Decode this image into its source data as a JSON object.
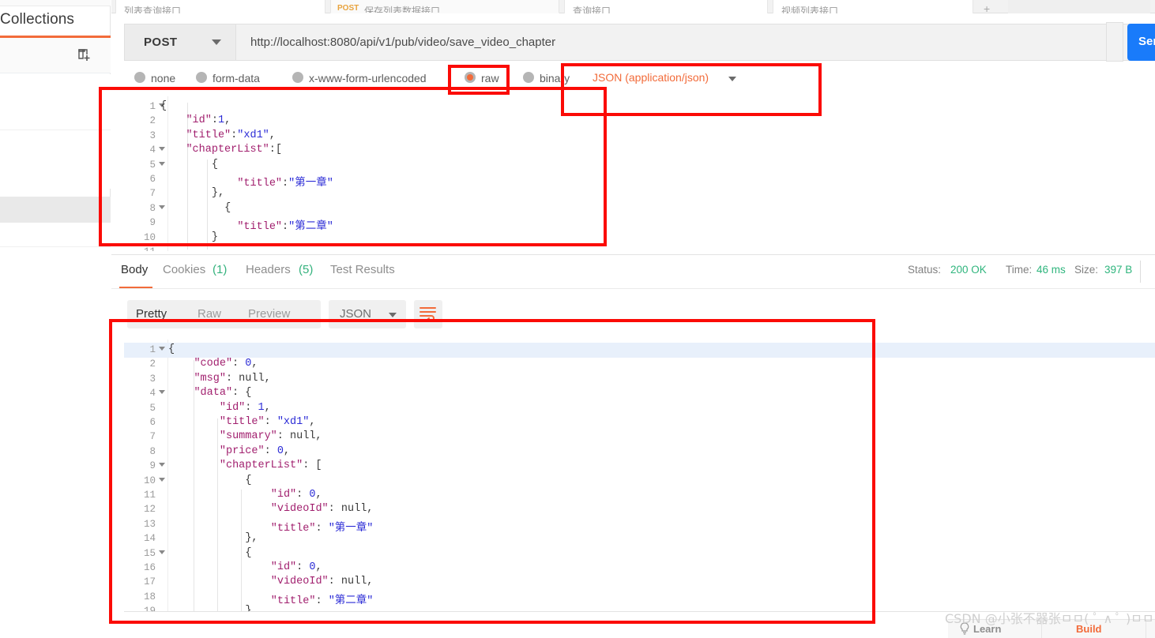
{
  "sidebar": {
    "title": "Collections",
    "new_folder_icon": "new-folder-icon"
  },
  "tabstrip": {
    "tabs": [
      {
        "label": "列表查询接口",
        "method": "",
        "dirty": false
      },
      {
        "label": "保存列表数据接口",
        "method": "POST",
        "dirty": true
      },
      {
        "label": "查询接口",
        "method": "",
        "dirty": false
      },
      {
        "label": "视频列表接口",
        "method": "",
        "dirty": false
      }
    ],
    "plus_label": "+"
  },
  "request": {
    "method": "POST",
    "url": "http://localhost:8080/api/v1/pub/video/save_video_chapter",
    "send_label": "Send",
    "body_types": [
      {
        "label": "none",
        "selected": false
      },
      {
        "label": "form-data",
        "selected": false
      },
      {
        "label": "x-www-form-urlencoded",
        "selected": false
      },
      {
        "label": "raw",
        "selected": true
      },
      {
        "label": "binary",
        "selected": false
      }
    ],
    "raw_format": "JSON (application/json)",
    "body_lines": [
      {
        "n": "1",
        "fold": true,
        "text": "{"
      },
      {
        "n": "2",
        "fold": false,
        "text": "    \"id\":1,"
      },
      {
        "n": "3",
        "fold": false,
        "text": "    \"title\":\"xd1\","
      },
      {
        "n": "4",
        "fold": true,
        "text": "    \"chapterList\":["
      },
      {
        "n": "5",
        "fold": true,
        "text": "        {"
      },
      {
        "n": "6",
        "fold": false,
        "text": "            \"title\":\"第一章\""
      },
      {
        "n": "7",
        "fold": false,
        "text": "        },"
      },
      {
        "n": "8",
        "fold": true,
        "text": "          {"
      },
      {
        "n": "9",
        "fold": false,
        "text": "            \"title\":\"第二章\""
      },
      {
        "n": "10",
        "fold": false,
        "text": "        }"
      },
      {
        "n": "11",
        "fold": false,
        "text": ""
      }
    ]
  },
  "response": {
    "tabs": [
      {
        "label": "Body",
        "count": "",
        "active": true
      },
      {
        "label": "Cookies",
        "count": "(1)",
        "active": false
      },
      {
        "label": "Headers",
        "count": "(5)",
        "active": false
      },
      {
        "label": "Test Results",
        "count": "",
        "active": false
      }
    ],
    "status_label": "Status:",
    "status_value": "200 OK",
    "time_label": "Time:",
    "time_value": "46 ms",
    "size_label": "Size:",
    "size_value": "397 B",
    "format_tabs": [
      {
        "label": "Pretty",
        "active": true
      },
      {
        "label": "Raw",
        "active": false
      },
      {
        "label": "Preview",
        "active": false
      }
    ],
    "content_type": "JSON",
    "wrap_icon": "wrap-lines-icon",
    "body_lines": [
      {
        "n": "1",
        "fold": true,
        "text": "{",
        "hl": true
      },
      {
        "n": "2",
        "fold": false,
        "text": "    \"code\": 0,",
        "hl": false
      },
      {
        "n": "3",
        "fold": false,
        "text": "    \"msg\": null,",
        "hl": false
      },
      {
        "n": "4",
        "fold": true,
        "text": "    \"data\": {",
        "hl": false
      },
      {
        "n": "5",
        "fold": false,
        "text": "        \"id\": 1,",
        "hl": false
      },
      {
        "n": "6",
        "fold": false,
        "text": "        \"title\": \"xd1\",",
        "hl": false
      },
      {
        "n": "7",
        "fold": false,
        "text": "        \"summary\": null,",
        "hl": false
      },
      {
        "n": "8",
        "fold": false,
        "text": "        \"price\": 0,",
        "hl": false
      },
      {
        "n": "9",
        "fold": true,
        "text": "        \"chapterList\": [",
        "hl": false
      },
      {
        "n": "10",
        "fold": true,
        "text": "            {",
        "hl": false
      },
      {
        "n": "11",
        "fold": false,
        "text": "                \"id\": 0,",
        "hl": false
      },
      {
        "n": "12",
        "fold": false,
        "text": "                \"videoId\": null,",
        "hl": false
      },
      {
        "n": "13",
        "fold": false,
        "text": "                \"title\": \"第一章\"",
        "hl": false
      },
      {
        "n": "14",
        "fold": false,
        "text": "            },",
        "hl": false
      },
      {
        "n": "15",
        "fold": true,
        "text": "            {",
        "hl": false
      },
      {
        "n": "16",
        "fold": false,
        "text": "                \"id\": 0,",
        "hl": false
      },
      {
        "n": "17",
        "fold": false,
        "text": "                \"videoId\": null,",
        "hl": false
      },
      {
        "n": "18",
        "fold": false,
        "text": "                \"title\": \"第二章\"",
        "hl": false
      },
      {
        "n": "19",
        "fold": false,
        "text": "            }",
        "hl": false
      }
    ]
  },
  "bottom_bar": {
    "learn_label": "Learn",
    "build_label": "Build",
    "bulb_icon": "lightbulb-icon"
  },
  "watermark": {
    "text": "CSDN @小张不器张ㅁㅁ( ﾟ ∧ ﾟ )ㅁㅁ"
  },
  "colors": {
    "accent_orange": "#f26b3a",
    "send_blue": "#197bfa",
    "status_green": "#2fb57d",
    "annotation_red": "#fb0b06"
  }
}
